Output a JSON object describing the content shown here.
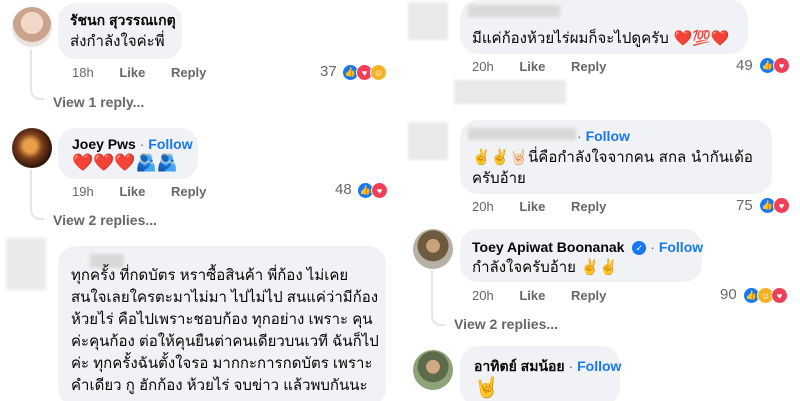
{
  "left": {
    "c1": {
      "name": "รัชนก สุวรรณเกตุ",
      "text": "ส่งกำลังใจค่ะพี่",
      "time": "18h",
      "like": "Like",
      "reply": "Reply",
      "count": "37",
      "view_replies": "View 1 reply..."
    },
    "c2": {
      "name": "Joey Pws",
      "follow": "Follow",
      "dot": "·",
      "text": "❤️❤️❤️🫂🫂",
      "time": "19h",
      "like": "Like",
      "reply": "Reply",
      "count": "48",
      "view_replies": "View 2 replies..."
    },
    "c3": {
      "text_lines": [
        "ทุกครั้ง ที่กดบัตร หราซื้อสินค้า พี่ก้อง ไม่เคย",
        "สนใจเลยใครตะมาไม่มา ไปไม่ไป สนแค่ว่ามีก้อง",
        "ห้วยไร่ คือไปเพราะชอบก้อง ทุกอย่าง เพราะ คุน",
        "ค่ะคุนก้อง ต่อให้คุนยืนต่าคนเดียวบนเวที ฉันก็ไป",
        "ค่ะ ทุกครั้งฉันตั้งใจรอ มากกะการกดบัตร เพราะ",
        "คำเดียว กู ฮักก้อง ห้วยไร่  จบข่าว แล้วพบกันนะ"
      ]
    }
  },
  "right": {
    "c1": {
      "text": "มีแค่ก้องห้วยไร่ผมก็จะไปดูครับ ❤️💯❤️",
      "time": "20h",
      "like": "Like",
      "reply": "Reply",
      "count": "49"
    },
    "c2": {
      "follow": "Follow",
      "dot": "·",
      "text_line1": "✌️✌️🤘🏻นี่คือกำลังใจจากคน สกล นำกันเด้อ",
      "text_line2": "ครับอ้าย",
      "time": "20h",
      "like": "Like",
      "reply": "Reply",
      "count": "75"
    },
    "c3": {
      "name": "Toey Apiwat Boonanak",
      "follow": "Follow",
      "text": "กำลังใจครับอ้าย ✌️✌️",
      "time": "20h",
      "like": "Like",
      "reply": "Reply",
      "count": "90",
      "view_replies": "View 2 replies..."
    },
    "c4": {
      "name": "อาทิตย์ สมน้อย",
      "dot": "·",
      "follow": "Follow",
      "text": "🤘"
    }
  },
  "icons": {
    "like": "like-reaction-icon",
    "love": "love-reaction-icon",
    "care": "care-reaction-icon",
    "verified": "verified-badge-icon"
  },
  "colors": {
    "accent": "#1877f2",
    "bubble": "#f0f2f5",
    "meta": "#65676b",
    "love": "#f33e58",
    "care": "#f7b125"
  }
}
